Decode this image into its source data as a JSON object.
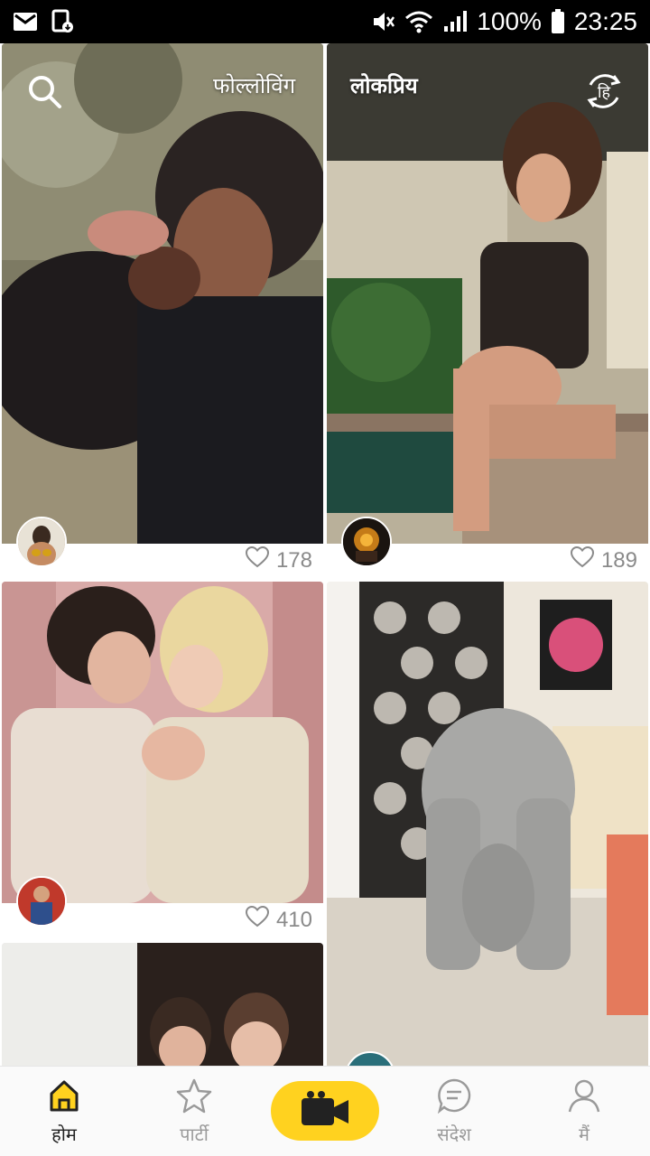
{
  "status_bar": {
    "battery": "100%",
    "time": "23:25",
    "icons": [
      "gmail-icon",
      "download-icon",
      "mute-icon",
      "wifi-icon",
      "signal-icon",
      "battery-icon"
    ]
  },
  "header": {
    "tabs": [
      {
        "label": "फोल्लोविंग",
        "active": false
      },
      {
        "label": "लोकप्रिय",
        "active": true
      }
    ],
    "language_icon_text": "हि"
  },
  "feed": {
    "cards": [
      {
        "likes": "178"
      },
      {
        "likes": "189"
      },
      {
        "likes": "410"
      },
      {
        "likes": ""
      },
      {
        "likes": ""
      }
    ]
  },
  "bottom_nav": {
    "items": [
      {
        "label": "होम",
        "icon": "home-icon",
        "active": true
      },
      {
        "label": "पार्टी",
        "icon": "star-icon",
        "active": false
      },
      {
        "label": "",
        "icon": "video-camera-icon",
        "active": false
      },
      {
        "label": "संदेश",
        "icon": "message-icon",
        "active": false
      },
      {
        "label": "मैं",
        "icon": "profile-icon",
        "active": false
      }
    ]
  },
  "colors": {
    "accent": "#ffd21f",
    "like_text": "#8a8a8a"
  }
}
